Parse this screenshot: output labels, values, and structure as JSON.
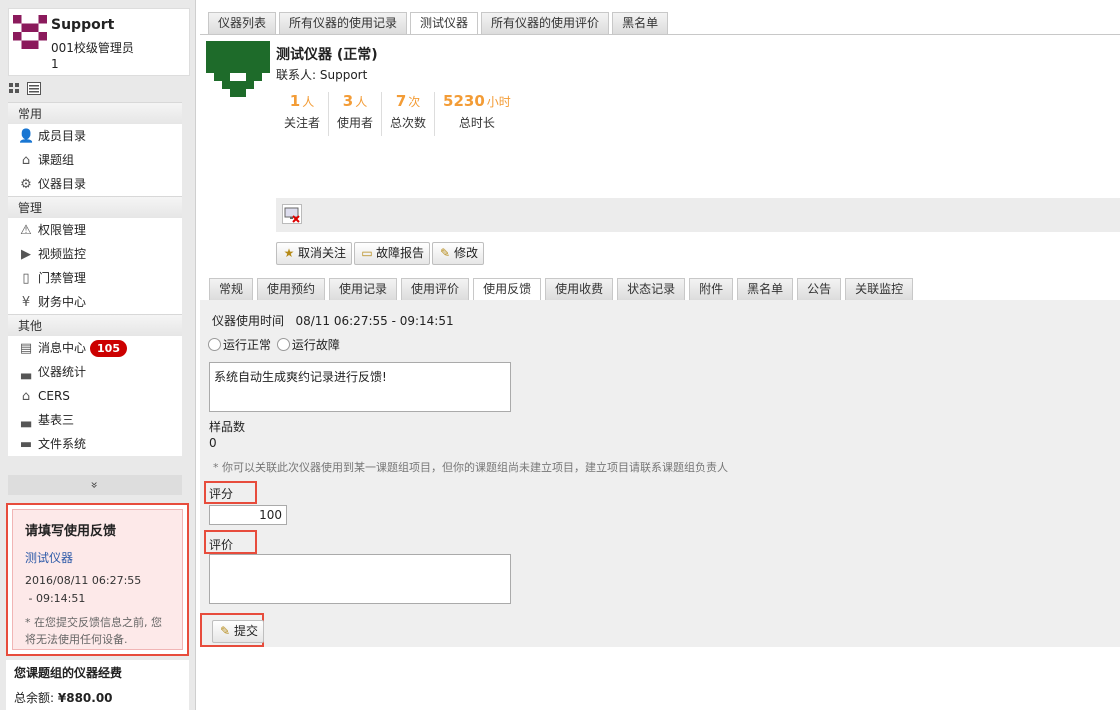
{
  "user": {
    "name": "Support",
    "role": "001校级管理员",
    "number": "1"
  },
  "sidebar": {
    "sections": [
      {
        "title": "常用",
        "items": [
          {
            "label": "成员目录",
            "icon": "people-icon"
          },
          {
            "label": "课题组",
            "icon": "home-icon"
          },
          {
            "label": "仪器目录",
            "icon": "gear-icon"
          }
        ]
      },
      {
        "title": "管理",
        "items": [
          {
            "label": "权限管理",
            "icon": "warning-icon"
          },
          {
            "label": "视频监控",
            "icon": "camera-icon"
          },
          {
            "label": "门禁管理",
            "icon": "door-icon"
          },
          {
            "label": "财务中心",
            "icon": "yen-icon"
          }
        ]
      },
      {
        "title": "其他",
        "items": [
          {
            "label": "消息中心",
            "icon": "message-icon",
            "badge": "105"
          },
          {
            "label": "仪器统计",
            "icon": "bar-chart-icon"
          },
          {
            "label": "CERS",
            "icon": "house-icon"
          },
          {
            "label": "基表三",
            "icon": "bar-chart-icon"
          },
          {
            "label": "文件系统",
            "icon": "folder-icon"
          }
        ]
      }
    ],
    "expand_symbol": "»"
  },
  "feedback_notice": {
    "title": "请填写使用反馈",
    "instrument_link": "测试仪器",
    "time_start": "2016/08/11 06:27:55",
    "time_end": " - 09:14:51",
    "note": "* 在您提交反馈信息之前, 您将无法使用任何设备."
  },
  "budget": {
    "title": "您课题组的仪器经费",
    "total_label": "总余额:",
    "total_value": "¥880.00"
  },
  "top_tabs": [
    "仪器列表",
    "所有仪器的使用记录",
    "测试仪器",
    "所有仪器的使用评价",
    "黑名单"
  ],
  "top_tabs_active": 2,
  "instrument": {
    "title": "测试仪器 (正常)",
    "contact": "联系人: Support",
    "stats": [
      {
        "value": "1",
        "unit": "人",
        "label": "关注者"
      },
      {
        "value": "3",
        "unit": "人",
        "label": "使用者"
      },
      {
        "value": "7",
        "unit": "次",
        "label": "总次数"
      },
      {
        "value": "5230",
        "unit": "小时",
        "label": "总时长"
      }
    ]
  },
  "actions": {
    "unfollow": "取消关注",
    "fault_report": "故障报告",
    "edit": "修改"
  },
  "sub_tabs": [
    "常规",
    "使用预约",
    "使用记录",
    "使用评价",
    "使用反馈",
    "使用收费",
    "状态记录",
    "附件",
    "黑名单",
    "公告",
    "关联监控"
  ],
  "sub_tabs_active": 4,
  "form": {
    "usage_time_label": "仪器使用时间",
    "usage_time_value": "08/11 06:27:55 - 09:14:51",
    "radio_normal": "运行正常",
    "radio_fault": "运行故障",
    "feedback_text": "系统自动生成爽约记录进行反馈!",
    "samples_label": "样品数",
    "samples_value": "0",
    "project_note": "* 你可以关联此次仪器使用到某一课题组项目，但你的课题组尚未建立项目，建立项目请联系课题组负责人",
    "rating_label": "评分",
    "rating_value": "100",
    "comment_label": "评价",
    "submit_label": "提交"
  },
  "colors": {
    "accent_orange": "#f39c36",
    "highlight_red": "#e74c3c",
    "badge_red": "#cc0000",
    "link_blue": "#2d5aa8",
    "logo_green": "#1e6b2a",
    "avatar_purple": "#8b1a5c"
  }
}
